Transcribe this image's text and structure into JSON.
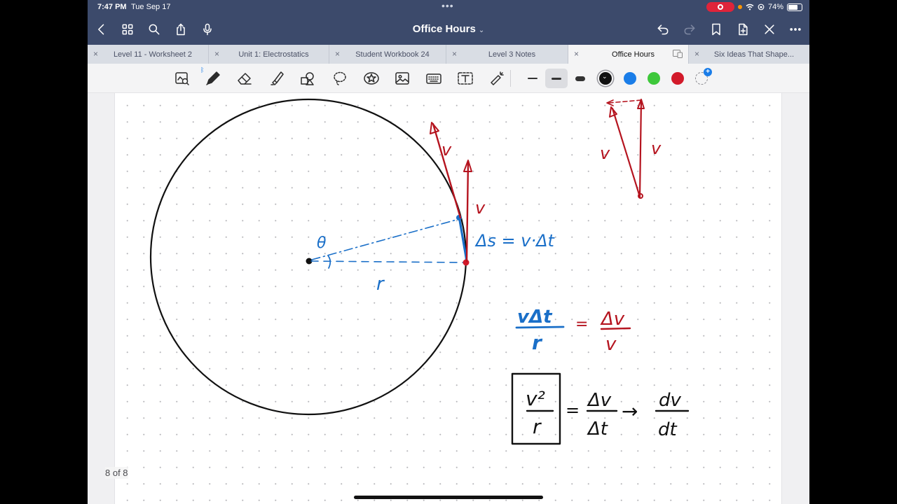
{
  "status": {
    "time": "7:47 PM",
    "date": "Tue Sep 17",
    "battery": "74%",
    "battery_level": 0.74,
    "dots": "•••"
  },
  "nav": {
    "title": "Office Hours",
    "title_chevron": "⌄"
  },
  "tabs": [
    {
      "label": "Level 11 - Worksheet 2",
      "active": false,
      "close": "×"
    },
    {
      "label": "Unit 1: Electrostatics",
      "active": false,
      "close": "×"
    },
    {
      "label": "Student Workbook 24",
      "active": false,
      "close": "×"
    },
    {
      "label": "Level 3 Notes",
      "active": false,
      "close": "×"
    },
    {
      "label": "Office Hours",
      "active": true,
      "close": "×"
    },
    {
      "label": "Six Ideas That Shape...",
      "active": false,
      "close": "×"
    }
  ],
  "toolbar": {
    "tools": [
      "lasso-zoom-tool",
      "pen-tool",
      "eraser-tool",
      "highlighter-tool",
      "shapes-tool",
      "lasso-tool",
      "elements-tool",
      "image-tool",
      "keyboard-tool",
      "text-tool",
      "laser-pointer-tool"
    ],
    "colors": [
      "#111111",
      "#1a7de8",
      "#3ec83b",
      "#d21a2a"
    ],
    "selected_color": "#111111",
    "selected_thickness": "medium"
  },
  "page": {
    "indicator": "8 of 8",
    "labels": {
      "theta": "θ",
      "r": "r",
      "v1": "v",
      "v2": "v",
      "v3": "v",
      "v4": "v",
      "ds_eq": "Δs = v·Δt",
      "frac1_num": "vΔt",
      "frac1_den": "r",
      "eq1": "=",
      "frac2_num": "Δv",
      "frac2_den": "v",
      "box_num": "v²",
      "box_den": "r",
      "eq2": "=",
      "frac3_num": "Δv",
      "frac3_den": "Δt",
      "arrow": "→",
      "frac4_num": "dv",
      "frac4_den": "dt"
    }
  }
}
